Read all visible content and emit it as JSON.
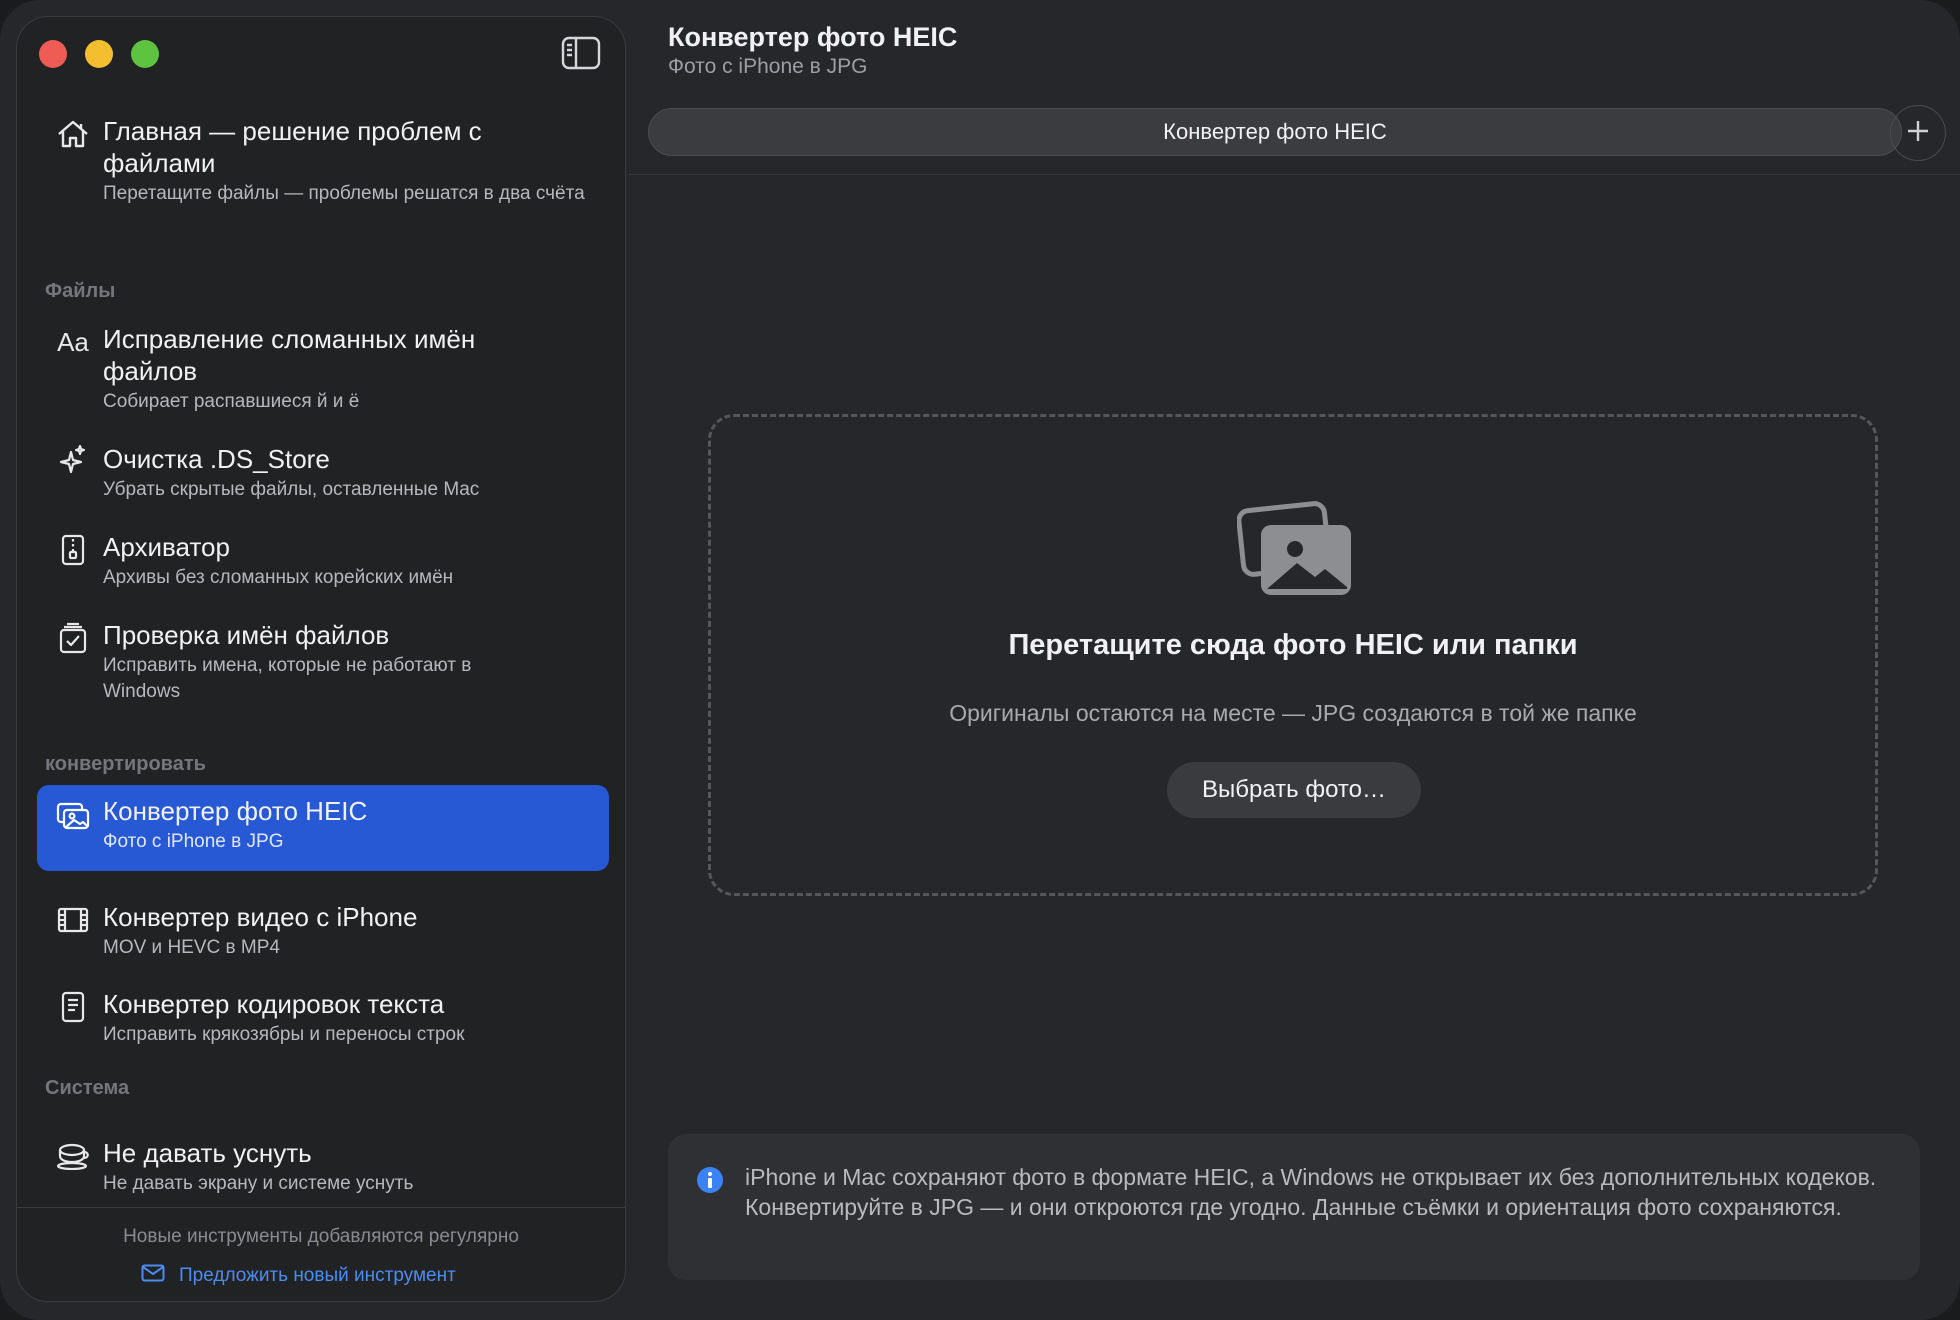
{
  "header": {
    "title": "Конвертер фото HEIC",
    "subtitle": "Фото с iPhone в JPG"
  },
  "tabs": [
    {
      "label": "Конвертер фото HEIC"
    }
  ],
  "sidebar": {
    "home": {
      "title": "Главная — решение проблем с файлами",
      "subtitle": "Перетащите файлы — проблемы решатся в два счёта",
      "icon": "home-icon"
    },
    "sections": [
      {
        "label": "Файлы",
        "items": [
          {
            "title": "Исправление сломанных имён файлов",
            "subtitle": "Собирает распавшиеся й и ё",
            "icon": "text-format-icon",
            "icon_glyph": "Aa"
          },
          {
            "title": "Очистка .DS_Store",
            "subtitle": "Убрать скрытые файлы, оставленные Mac",
            "icon": "sparkles-icon"
          },
          {
            "title": "Архиватор",
            "subtitle": "Архивы без сломанных корейских имён",
            "icon": "zip-icon"
          },
          {
            "title": "Проверка имён файлов",
            "subtitle": "Исправить имена, которые не работают в Windows",
            "icon": "checklist-icon"
          }
        ]
      },
      {
        "label": "конвертировать",
        "items": [
          {
            "title": "Конвертер фото HEIC",
            "subtitle": "Фото с iPhone в JPG",
            "icon": "photos-icon",
            "active": true
          },
          {
            "title": "Конвертер видео с iPhone",
            "subtitle": "MOV и HEVC в MP4",
            "icon": "film-icon"
          },
          {
            "title": "Конвертер кодировок текста",
            "subtitle": "Исправить крякозябры и переносы строк",
            "icon": "document-icon"
          }
        ]
      },
      {
        "label": "Система",
        "items": [
          {
            "title": "Не давать уснуть",
            "subtitle": "Не давать экрану и системе уснуть",
            "icon": "coffee-cup-icon"
          }
        ]
      }
    ],
    "footer": {
      "note": "Новые инструменты добавляются регулярно",
      "suggest_link": "Предложить новый инструмент",
      "icon": "envelope-icon"
    }
  },
  "dropzone": {
    "title": "Перетащите сюда фото HEIC или папки",
    "subtitle": "Оригиналы остаются на месте — JPG создаются в той же папке",
    "button": "Выбрать фото…",
    "icon": "photos-icon"
  },
  "info": {
    "text": "iPhone и Mac сохраняют фото в формате HEIC, а Windows не открывает их без дополнительных кодеков. Конвертируйте в JPG — и они откроются где угодно. Данные съёмки и ориентация фото сохраняются.",
    "icon": "info-circle-icon"
  },
  "colors": {
    "accent": "#2759d5",
    "link": "#4b8cf2",
    "info_icon": "#3b82f6",
    "window_bg": "#26272a",
    "sidebar_bg": "#212224"
  }
}
